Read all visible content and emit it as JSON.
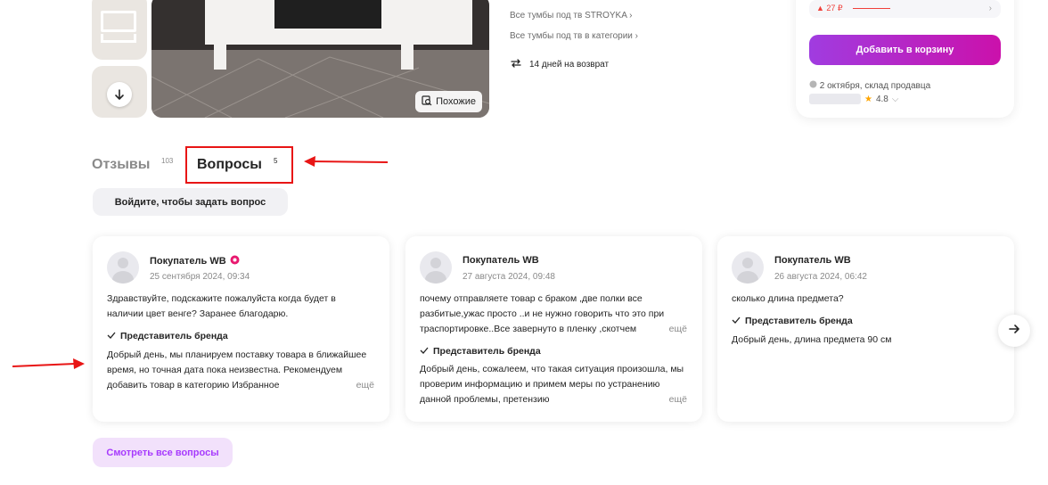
{
  "gallery": {
    "similar_label": "Похожие"
  },
  "product_links": {
    "brand_link": "Все тумбы под тв STROYKA",
    "category_link": "Все тумбы под тв в категории",
    "return_text": "14 дней на возврат"
  },
  "buy_card": {
    "price_delta": "▲ 27 ₽",
    "add_to_cart": "Добавить в корзину",
    "delivery": "2 октября, склад продавца",
    "rating": "4.8"
  },
  "tabs": {
    "reviews_label": "Отзывы",
    "reviews_count": "103",
    "questions_label": "Вопросы",
    "questions_count": "5"
  },
  "ask_button": "Войдите, чтобы задать вопрос",
  "questions": [
    {
      "author": "Покупатель WB",
      "date": "25 сентября 2024, 09:34",
      "question": "Здравствуйте, подскажите пожалуйста когда будет в наличии цвет венге? Заранее благодарю.",
      "answer_label": "Представитель бренда",
      "answer": "Добрый день, мы планируем поставку товара в ближайшее время, но точная дата пока неизвестна. Рекомендуем добавить товар в категорию Избранное",
      "more": "ещё"
    },
    {
      "author": "Покупатель WB",
      "date": "27 августа 2024, 09:48",
      "question": "почему отправляете товар с браком ,две полки все разбитые,ужас просто ..и не нужно говорить что это при траспортировке..Все завернуто в пленку ,скотчем",
      "answer_label": "Представитель бренда",
      "answer": "Добрый день, сожалеем, что такая ситуация произошла, мы проверим информацию и примем меры по устранению данной проблемы, претензию",
      "more": "ещё"
    },
    {
      "author": "Покупатель WB",
      "date": "26 августа 2024, 06:42",
      "question": "сколько длина предмета?",
      "answer_label": "Представитель бренда",
      "answer": "Добрый день, длина предмета 90 см",
      "more": ""
    }
  ],
  "all_questions_button": "Смотреть все вопросы",
  "colors": {
    "accent": "#a73afd",
    "cart_gradient_start": "#a03ce0",
    "cart_gradient_end": "#cb11ab",
    "annotation_red": "#e81515",
    "badge_pink": "#e8196f"
  },
  "icons": {
    "scroll_down": "arrow-down-icon",
    "similar": "similar-search-icon",
    "return": "exchange-arrows-icon",
    "next": "arrow-right-icon",
    "check": "checkmark-icon"
  }
}
